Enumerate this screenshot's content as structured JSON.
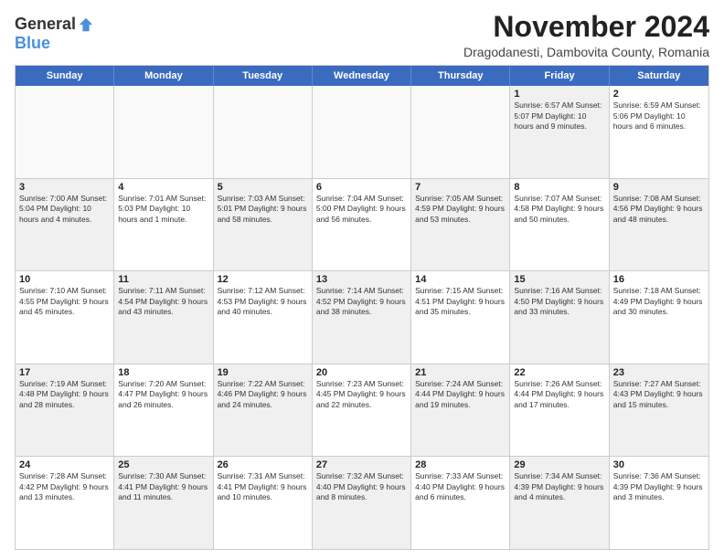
{
  "logo": {
    "general": "General",
    "blue": "Blue"
  },
  "title": "November 2024",
  "subtitle": "Dragodanesti, Dambovita County, Romania",
  "header_days": [
    "Sunday",
    "Monday",
    "Tuesday",
    "Wednesday",
    "Thursday",
    "Friday",
    "Saturday"
  ],
  "rows": [
    [
      {
        "day": "",
        "text": "",
        "empty": true
      },
      {
        "day": "",
        "text": "",
        "empty": true
      },
      {
        "day": "",
        "text": "",
        "empty": true
      },
      {
        "day": "",
        "text": "",
        "empty": true
      },
      {
        "day": "",
        "text": "",
        "empty": true
      },
      {
        "day": "1",
        "text": "Sunrise: 6:57 AM\nSunset: 5:07 PM\nDaylight: 10 hours and 9 minutes.",
        "shaded": true
      },
      {
        "day": "2",
        "text": "Sunrise: 6:59 AM\nSunset: 5:06 PM\nDaylight: 10 hours and 6 minutes.",
        "shaded": false
      }
    ],
    [
      {
        "day": "3",
        "text": "Sunrise: 7:00 AM\nSunset: 5:04 PM\nDaylight: 10 hours and 4 minutes.",
        "shaded": true
      },
      {
        "day": "4",
        "text": "Sunrise: 7:01 AM\nSunset: 5:03 PM\nDaylight: 10 hours and 1 minute.",
        "shaded": false
      },
      {
        "day": "5",
        "text": "Sunrise: 7:03 AM\nSunset: 5:01 PM\nDaylight: 9 hours and 58 minutes.",
        "shaded": true
      },
      {
        "day": "6",
        "text": "Sunrise: 7:04 AM\nSunset: 5:00 PM\nDaylight: 9 hours and 56 minutes.",
        "shaded": false
      },
      {
        "day": "7",
        "text": "Sunrise: 7:05 AM\nSunset: 4:59 PM\nDaylight: 9 hours and 53 minutes.",
        "shaded": true
      },
      {
        "day": "8",
        "text": "Sunrise: 7:07 AM\nSunset: 4:58 PM\nDaylight: 9 hours and 50 minutes.",
        "shaded": false
      },
      {
        "day": "9",
        "text": "Sunrise: 7:08 AM\nSunset: 4:56 PM\nDaylight: 9 hours and 48 minutes.",
        "shaded": true
      }
    ],
    [
      {
        "day": "10",
        "text": "Sunrise: 7:10 AM\nSunset: 4:55 PM\nDaylight: 9 hours and 45 minutes.",
        "shaded": false
      },
      {
        "day": "11",
        "text": "Sunrise: 7:11 AM\nSunset: 4:54 PM\nDaylight: 9 hours and 43 minutes.",
        "shaded": true
      },
      {
        "day": "12",
        "text": "Sunrise: 7:12 AM\nSunset: 4:53 PM\nDaylight: 9 hours and 40 minutes.",
        "shaded": false
      },
      {
        "day": "13",
        "text": "Sunrise: 7:14 AM\nSunset: 4:52 PM\nDaylight: 9 hours and 38 minutes.",
        "shaded": true
      },
      {
        "day": "14",
        "text": "Sunrise: 7:15 AM\nSunset: 4:51 PM\nDaylight: 9 hours and 35 minutes.",
        "shaded": false
      },
      {
        "day": "15",
        "text": "Sunrise: 7:16 AM\nSunset: 4:50 PM\nDaylight: 9 hours and 33 minutes.",
        "shaded": true
      },
      {
        "day": "16",
        "text": "Sunrise: 7:18 AM\nSunset: 4:49 PM\nDaylight: 9 hours and 30 minutes.",
        "shaded": false
      }
    ],
    [
      {
        "day": "17",
        "text": "Sunrise: 7:19 AM\nSunset: 4:48 PM\nDaylight: 9 hours and 28 minutes.",
        "shaded": true
      },
      {
        "day": "18",
        "text": "Sunrise: 7:20 AM\nSunset: 4:47 PM\nDaylight: 9 hours and 26 minutes.",
        "shaded": false
      },
      {
        "day": "19",
        "text": "Sunrise: 7:22 AM\nSunset: 4:46 PM\nDaylight: 9 hours and 24 minutes.",
        "shaded": true
      },
      {
        "day": "20",
        "text": "Sunrise: 7:23 AM\nSunset: 4:45 PM\nDaylight: 9 hours and 22 minutes.",
        "shaded": false
      },
      {
        "day": "21",
        "text": "Sunrise: 7:24 AM\nSunset: 4:44 PM\nDaylight: 9 hours and 19 minutes.",
        "shaded": true
      },
      {
        "day": "22",
        "text": "Sunrise: 7:26 AM\nSunset: 4:44 PM\nDaylight: 9 hours and 17 minutes.",
        "shaded": false
      },
      {
        "day": "23",
        "text": "Sunrise: 7:27 AM\nSunset: 4:43 PM\nDaylight: 9 hours and 15 minutes.",
        "shaded": true
      }
    ],
    [
      {
        "day": "24",
        "text": "Sunrise: 7:28 AM\nSunset: 4:42 PM\nDaylight: 9 hours and 13 minutes.",
        "shaded": false
      },
      {
        "day": "25",
        "text": "Sunrise: 7:30 AM\nSunset: 4:41 PM\nDaylight: 9 hours and 11 minutes.",
        "shaded": true
      },
      {
        "day": "26",
        "text": "Sunrise: 7:31 AM\nSunset: 4:41 PM\nDaylight: 9 hours and 10 minutes.",
        "shaded": false
      },
      {
        "day": "27",
        "text": "Sunrise: 7:32 AM\nSunset: 4:40 PM\nDaylight: 9 hours and 8 minutes.",
        "shaded": true
      },
      {
        "day": "28",
        "text": "Sunrise: 7:33 AM\nSunset: 4:40 PM\nDaylight: 9 hours and 6 minutes.",
        "shaded": false
      },
      {
        "day": "29",
        "text": "Sunrise: 7:34 AM\nSunset: 4:39 PM\nDaylight: 9 hours and 4 minutes.",
        "shaded": true
      },
      {
        "day": "30",
        "text": "Sunrise: 7:36 AM\nSunset: 4:39 PM\nDaylight: 9 hours and 3 minutes.",
        "shaded": false
      }
    ]
  ]
}
